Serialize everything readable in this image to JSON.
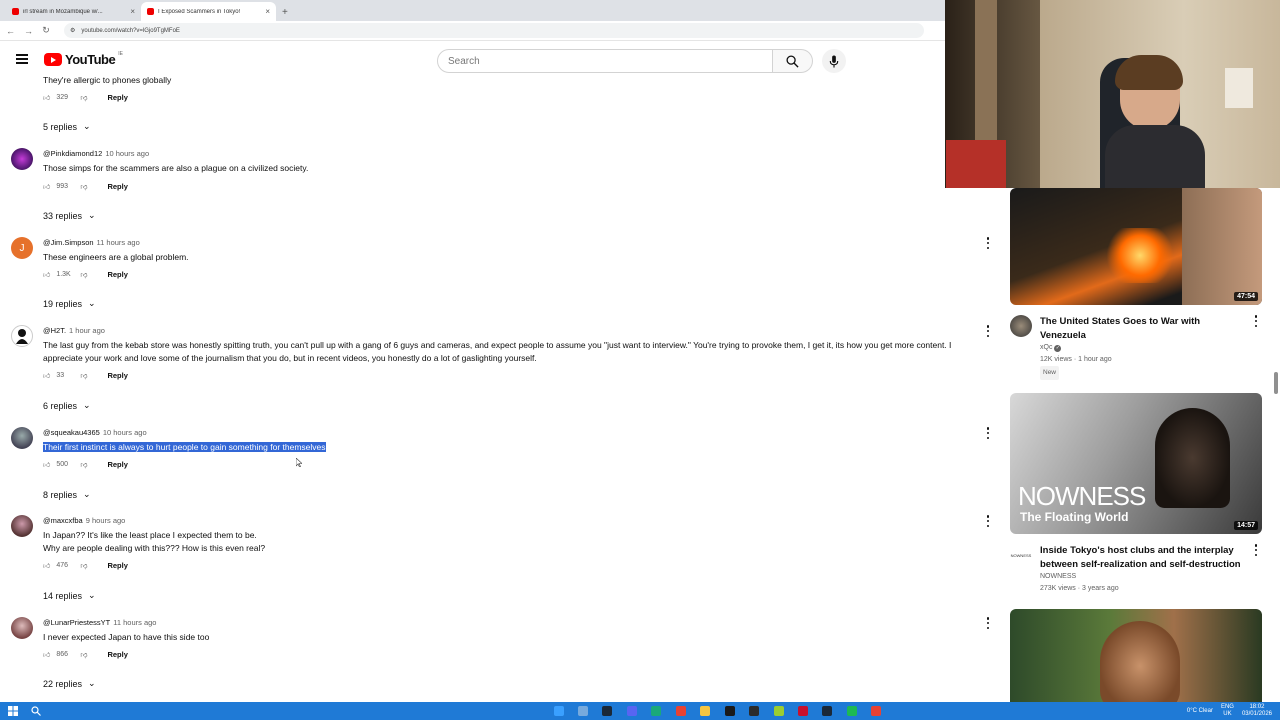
{
  "browser": {
    "tabs": [
      {
        "label": "irl stream in Mozambique w/...",
        "active": false
      },
      {
        "label": "I Exposed Scammers in Tokyo!",
        "active": true
      }
    ],
    "url": "youtube.com/watch?v=lGjo9TgMFoE"
  },
  "header": {
    "logo_text": "YouTube",
    "logo_sup": "IE",
    "search_placeholder": "Search"
  },
  "comments": [
    {
      "partial_text": "They're allergic to phones globally",
      "likes": "329",
      "reply_label": "Reply",
      "replies": "5 replies"
    },
    {
      "author": "@Pinkdiamond12",
      "time": "10 hours ago",
      "text": "Those simps for the scammers are also a plague  on a civilized society.",
      "likes": "993",
      "reply_label": "Reply",
      "replies": "33 replies"
    },
    {
      "author": "@Jim.Simpson",
      "time": "11 hours ago",
      "avatar_letter": "J",
      "text": "These engineers are a global problem.",
      "likes": "1.3K",
      "reply_label": "Reply",
      "replies": "19 replies"
    },
    {
      "author": "@H2T.",
      "time": "1 hour ago",
      "text": "The last guy from the kebab store was honestly spitting truth, you can't pull up with a gang of 6 guys and cameras, and expect people to assume you \"just want to interview.\" You're trying to provoke them, I get it, its how you get more content. I appreciate your work and love some of the journalism that you do, but in recent videos, you honestly do a lot of gaslighting yourself.",
      "likes": "33",
      "reply_label": "Reply",
      "replies": "6 replies"
    },
    {
      "author": "@squeakau4365",
      "time": "10 hours ago",
      "text": "Their first instinct is always to hurt people to gain something for themselves",
      "likes": "500",
      "reply_label": "Reply",
      "replies": "8 replies"
    },
    {
      "author": "@maxcxfba",
      "time": "9 hours ago",
      "text_line1": "In Japan?? It's like the least place I expected them to be.",
      "text_line2": "Why are people dealing with this??? How is this even real?",
      "likes": "476",
      "reply_label": "Reply",
      "replies": "14 replies"
    },
    {
      "author": "@LunarPriestessYT",
      "time": "11 hours ago",
      "text": "I never expected Japan to have this side too",
      "likes": "866",
      "reply_label": "Reply",
      "replies": "22 replies"
    }
  ],
  "sidebar": {
    "videos": [
      {
        "duration": "47:54",
        "title": "The United States Goes to War with Venezuela",
        "channel": "xQc",
        "views": "12K views",
        "age": "1 hour ago",
        "badge": "New"
      },
      {
        "thumb_text": "NOWNESS",
        "thumb_subtext": "The Floating World",
        "duration": "14:57",
        "title": "Inside Tokyo's host clubs and the interplay between self-realization and self-destruction",
        "channel": "NOWNESS",
        "views": "273K views",
        "age": "3 years ago"
      }
    ]
  },
  "taskbar": {
    "weather": "0°C  Clear",
    "lang": "ENG",
    "lang_sub": "UK",
    "time": "18:02",
    "date": "03/01/2026"
  },
  "colors": {
    "accent": "#ff0000",
    "highlight": "#3367d6",
    "taskbar": "#1f7ad6"
  }
}
